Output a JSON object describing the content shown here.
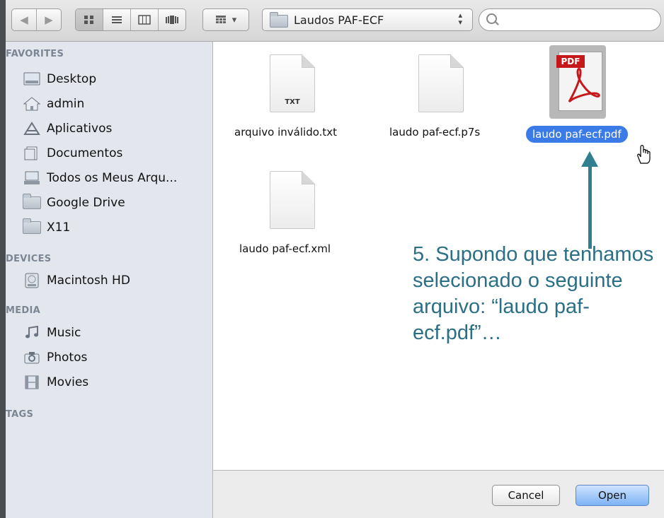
{
  "toolbar": {
    "nav_back_icon": "chevron-left-icon",
    "nav_forward_icon": "chevron-right-icon",
    "view_modes": [
      "icon-view",
      "list-view",
      "column-view",
      "coverflow-view"
    ],
    "arrange_icon": "arrange-grid-icon",
    "path_label": "Laudos PAF-ECF",
    "search_placeholder": ""
  },
  "sidebar": {
    "favorites_heading": "FAVORITES",
    "favorites": [
      {
        "label": "Desktop",
        "icon": "desktop-icon"
      },
      {
        "label": "admin",
        "icon": "home-icon"
      },
      {
        "label": "Aplicativos",
        "icon": "applications-icon"
      },
      {
        "label": "Documentos",
        "icon": "documents-icon"
      },
      {
        "label": "Todos os Meus Arqu...",
        "icon": "all-files-icon"
      },
      {
        "label": "Google Drive",
        "icon": "folder-icon"
      },
      {
        "label": "X11",
        "icon": "folder-icon"
      }
    ],
    "devices_heading": "DEVICES",
    "devices": [
      {
        "label": "Macintosh HD",
        "icon": "hard-drive-icon"
      }
    ],
    "media_heading": "MEDIA",
    "media": [
      {
        "label": "Music",
        "icon": "music-icon"
      },
      {
        "label": "Photos",
        "icon": "camera-icon"
      },
      {
        "label": "Movies",
        "icon": "film-icon"
      }
    ],
    "tags_heading": "TAGS"
  },
  "files": [
    {
      "name": "arquivo inválido.txt",
      "ext": "TXT"
    },
    {
      "name": "laudo paf-ecf.p7s",
      "ext": ""
    },
    {
      "name": "laudo paf-ecf.pdf",
      "ext": "PDF",
      "selected": true
    },
    {
      "name": "laudo paf-ecf.xml",
      "ext": ""
    }
  ],
  "annotation": {
    "step_text": "5. Supondo que tenhamos selecionado o seguinte arquivo: “laudo paf-ecf.pdf”…"
  },
  "buttons": {
    "cancel": "Cancel",
    "open": "Open"
  },
  "colors": {
    "selection": "#3b7be8",
    "annotation": "#2b6f86",
    "pdf_red": "#c6171b"
  }
}
